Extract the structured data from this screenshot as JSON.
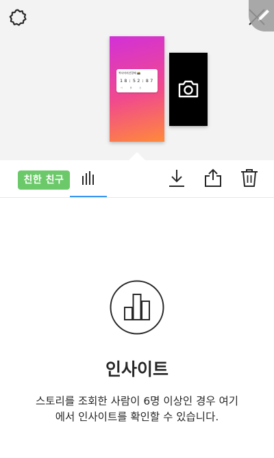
{
  "preview": {
    "countdown": {
      "title": "복사미지선정때 📸",
      "digits": "18:52:87",
      "units": "시 분 초"
    }
  },
  "toolbar": {
    "close_friends_label": "친한 친구"
  },
  "insights": {
    "heading": "인사이트",
    "description": "스토리를 조회한 사람이 6명 이상인 경우 여기에서 인사이트를 확인할 수 있습니다."
  },
  "colors": {
    "close_friends": "#6cc96a",
    "tab_underline": "#3897f0",
    "story_gradient": [
      "#d230d8",
      "#f14a8c",
      "#ff8a3a"
    ]
  }
}
